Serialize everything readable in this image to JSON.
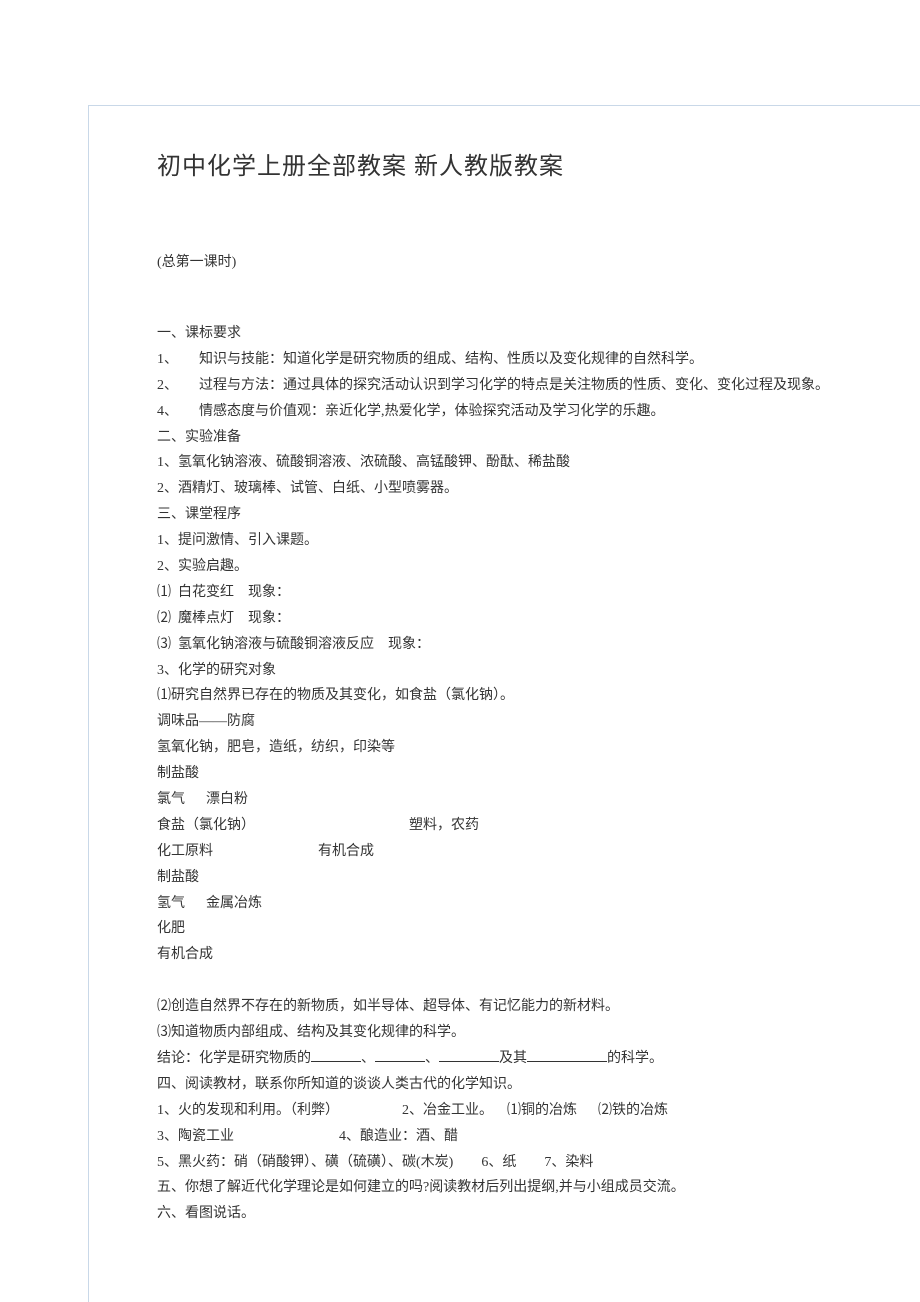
{
  "title": "初中化学上册全部教案 新人教版教案",
  "subtitle": "(总第一课时)",
  "lines": {
    "l1": "一、课标要求",
    "l2": "1、      知识与技能：知道化学是研究物质的组成、结构、性质以及变化规律的自然科学。",
    "l3": "2、      过程与方法：通过具体的探究活动认识到学习化学的特点是关注物质的性质、变化、变化过程及现象。",
    "l4": "4、      情感态度与价值观：亲近化学,热爱化学，体验探究活动及学习化学的乐趣。",
    "l5": "二、实验准备",
    "l6": "1、氢氧化钠溶液、硫酸铜溶液、浓硫酸、高锰酸钾、酚酞、稀盐酸",
    "l7": "2、酒精灯、玻璃棒、试管、白纸、小型喷雾器。",
    "l8": "三、课堂程序",
    "l9": "1、提问激情、引入课题。",
    "l10": "2、实验启趣。",
    "l11": "⑴  白花变红    现象：",
    "l12": "⑵  魔棒点灯    现象：",
    "l13": "⑶  氢氧化钠溶液与硫酸铜溶液反应    现象：",
    "l14": "3、化学的研究对象",
    "l15": "⑴研究自然界已存在的物质及其变化，如食盐（氯化钠）。",
    "l16": "调味品——防腐",
    "l17": "氢氧化钠，肥皂，造纸，纺织，印染等",
    "l18": "制盐酸",
    "l19": "氯气      漂白粉",
    "l20a": "食盐（氯化钠）",
    "l20b": "塑料，农药",
    "l21a": "化工原料",
    "l21b": "有机合成",
    "l22": "制盐酸",
    "l23": "氢气      金属冶炼",
    "l24": "化肥",
    "l25": "有机合成",
    "l26": "⑵创造自然界不存在的新物质，如半导体、超导体、有记忆能力的新材料。",
    "l27": "⑶知道物质内部组成、结构及其变化规律的科学。",
    "l28a": "结论：化学是研究物质的",
    "l28b": "、",
    "l28c": "、",
    "l28d": "及其",
    "l28e": "的科学。",
    "l29": "四、阅读教材，联系你所知道的谈谈人类古代的化学知识。",
    "l30": "1、火的发现和利用。（利弊）                  2、冶金工业。    ⑴铜的冶炼      ⑵铁的冶炼",
    "l31": "3、陶瓷工业                              4、酿造业：酒、醋",
    "l32": "5、黑火药：硝（硝酸钾）、磺（硫磺）、碳(木炭)        6、纸        7、染料",
    "l33": "五、你想了解近代化学理论是如何建立的吗?阅读教材后列出提纲,并与小组成员交流。",
    "l34": "六、看图说话。"
  }
}
